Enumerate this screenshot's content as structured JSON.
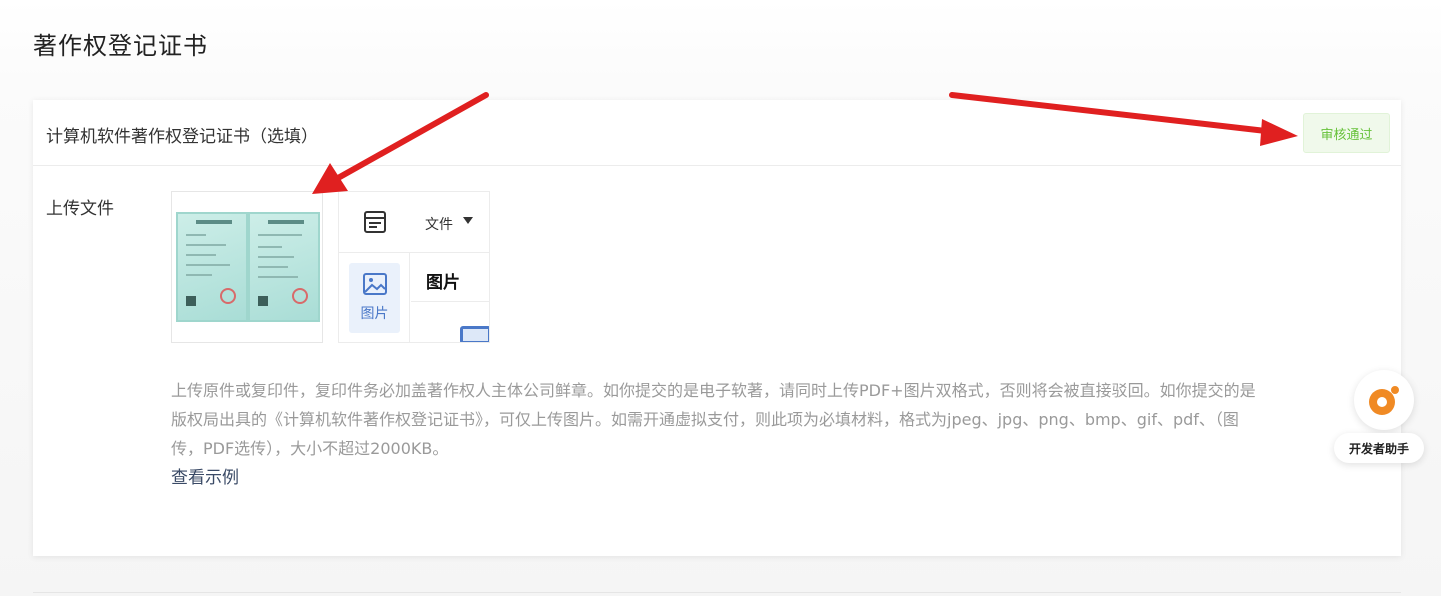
{
  "page": {
    "title": "著作权登记证书"
  },
  "card": {
    "title": "计算机软件著作权登记证书（选填）",
    "status": "审核通过",
    "status_color": "#67c23a"
  },
  "upload": {
    "label": "上传文件",
    "thumbnail_icon": "certificate-image",
    "preview": {
      "file_menu_label": "文件",
      "side_button_label": "图片",
      "main_title": "图片"
    },
    "hint_lines": [
      "上传原件或复印件，复印件务必加盖著作权人主体公司鲜章。如你提交的是电子软著，请同时上传PDF+图片双格式，否则将会被直接驳回。如你提交的是",
      "版权局出具的《计算机软件著作权登记证书》，可仅上传图片。如需开通虚拟支付，则此项为必填材料，格式为jpeg、jpg、png、bmp、gif、pdf、（图",
      "传，PDF选传），大小不超过2000KB。"
    ],
    "example_link": "查看示例"
  },
  "assistant": {
    "label": "开发者助手",
    "accent": "#f08a24"
  },
  "annotation": {
    "arrow_color": "#e02020"
  }
}
